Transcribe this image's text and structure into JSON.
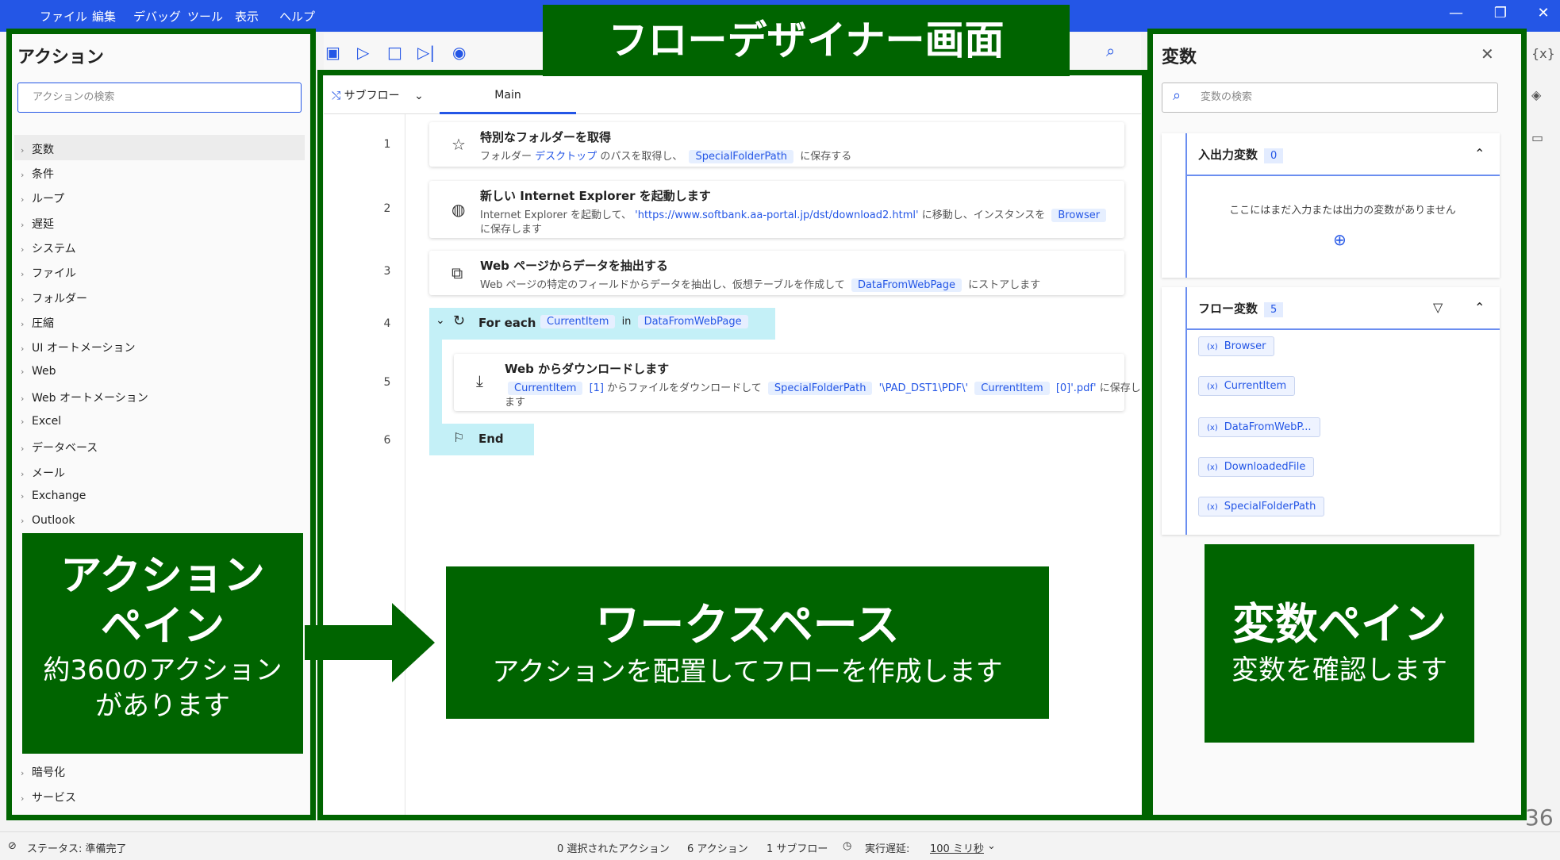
{
  "menu": [
    "ファイル",
    "編集",
    "デバッグ",
    "ツール",
    "表示",
    "ヘルプ"
  ],
  "window_controls": {
    "minimize": "—",
    "restore": "❐",
    "close": "✕"
  },
  "overlay": {
    "title": "フローデザイナー画面",
    "action_pane_title_1": "アクション",
    "action_pane_title_2": "ペイン",
    "action_pane_sub_1": "約360のアクション",
    "action_pane_sub_2": "があります",
    "workspace_title": "ワークスペース",
    "workspace_sub": "アクションを配置してフローを作成します",
    "var_pane_title": "変数ペイン",
    "var_pane_sub": "変数を確認します",
    "page_number": "36"
  },
  "actions_pane": {
    "title": "アクション",
    "search_placeholder": "アクションの検索",
    "items": [
      "変数",
      "条件",
      "ループ",
      "遅延",
      "システム",
      "ファイル",
      "フォルダー",
      "圧縮",
      "UI オートメーション",
      "Web",
      "Web オートメーション",
      "Excel",
      "データベース",
      "メール",
      "Exchange",
      "Outlook"
    ],
    "bottom_items": [
      "暗号化",
      "サービス"
    ]
  },
  "workspace": {
    "subflow_label": "サブフロー",
    "tab_main": "Main",
    "steps": [
      {
        "num": "1",
        "title": "特別なフォルダーを取得",
        "desc_a": "フォルダー",
        "desc_link": "デスクトップ",
        "desc_b": "のパスを取得し、",
        "chip": "SpecialFolderPath",
        "desc_c": "に保存する"
      },
      {
        "num": "2",
        "title": "新しい Internet Explorer を起動します",
        "desc_a": "Internet Explorer を起動して、",
        "desc_link": "'https://www.softbank.aa-portal.jp/dst/download2.html'",
        "desc_b": "に移動し、インスタンスを",
        "chip": "Browser",
        "desc_c": "に保存します"
      },
      {
        "num": "3",
        "title": "Web ページからデータを抽出する",
        "desc_a": "Web ページの特定のフィールドからデータを抽出し、仮想テーブルを作成して",
        "chip": "DataFromWebPage",
        "desc_c": "にストアします"
      },
      {
        "num": "4",
        "title": "For each",
        "chip1": "CurrentItem",
        "word": "in",
        "chip2": "DataFromWebPage"
      },
      {
        "num": "5",
        "title": "Web からダウンロードします",
        "chip1": "CurrentItem",
        "idx1": "[1]",
        "desc_a": "からファイルをダウンロードして",
        "chip2": "SpecialFolderPath",
        "desc_b": "'\\PAD_DST1\\PDF\\'",
        "chip3": "CurrentItem",
        "idx2": "[0]'.pdf'",
        "desc_c": "に保存し",
        "desc_d": "ます"
      },
      {
        "num": "6",
        "title": "End"
      }
    ]
  },
  "variables_pane": {
    "title": "変数",
    "search_placeholder": "変数の検索",
    "io_title": "入出力変数",
    "io_count": "0",
    "io_empty": "ここにはまだ入力または出力の変数がありません",
    "flow_title": "フロー変数",
    "flow_count": "5",
    "flow_vars": [
      "Browser",
      "CurrentItem",
      "DataFromWebP...",
      "DownloadedFile",
      "SpecialFolderPath"
    ]
  },
  "statusbar": {
    "status": "ステータス: 準備完了",
    "selected": "0 選択されたアクション",
    "actions": "6 アクション",
    "subflows": "1 サブフロー",
    "delay_label": "実行遅延:",
    "delay_value": "100 ミリ秒"
  }
}
